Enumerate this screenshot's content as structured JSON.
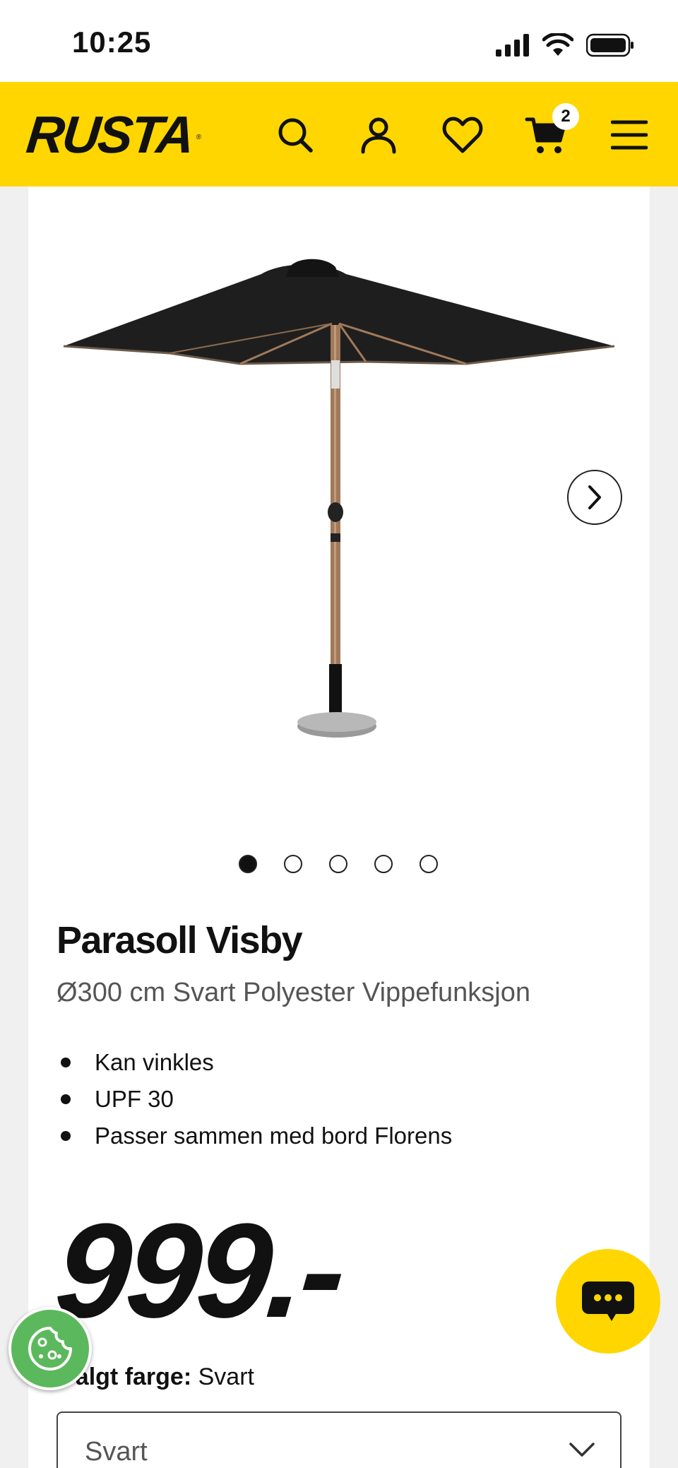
{
  "status_bar": {
    "time": "10:25"
  },
  "header": {
    "logo": "RUSTA",
    "logo_mark": "®",
    "icons": [
      "search-icon",
      "account-icon",
      "heart-icon",
      "cart-icon",
      "menu-icon"
    ],
    "cart_count": "2",
    "brand_color": "#ffd600"
  },
  "gallery": {
    "image_count": 5,
    "active_index": 0
  },
  "product": {
    "title": "Parasoll Visby",
    "subtitle": "Ø300 cm Svart Polyester Vippefunksjon",
    "features": [
      "Kan vinkles",
      "UPF 30",
      "Passer sammen med bord Florens"
    ],
    "price": "999.-"
  },
  "color_picker": {
    "label": "Valgt farge:",
    "value": "Svart",
    "selected": "Svart"
  },
  "floating": {
    "chat_icon": "chat-icon",
    "cookie_icon": "cookie-icon"
  }
}
